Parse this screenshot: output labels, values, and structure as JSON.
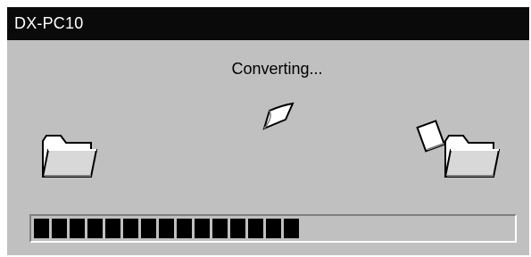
{
  "window": {
    "title": "DX-PC10"
  },
  "dialog": {
    "status": "Converting..."
  },
  "icons": {
    "source": "folder-icon",
    "destination": "folder-icon",
    "moving_item": "document-icon",
    "source_item": "document-icon"
  },
  "progress": {
    "value_percent": 55,
    "total_blocks": 27,
    "filled_blocks": 15
  },
  "colors": {
    "titlebar_bg": "#0a0a0a",
    "titlebar_text": "#ffffff",
    "window_bg": "#c0c0c0",
    "progress_fill": "#000000"
  }
}
